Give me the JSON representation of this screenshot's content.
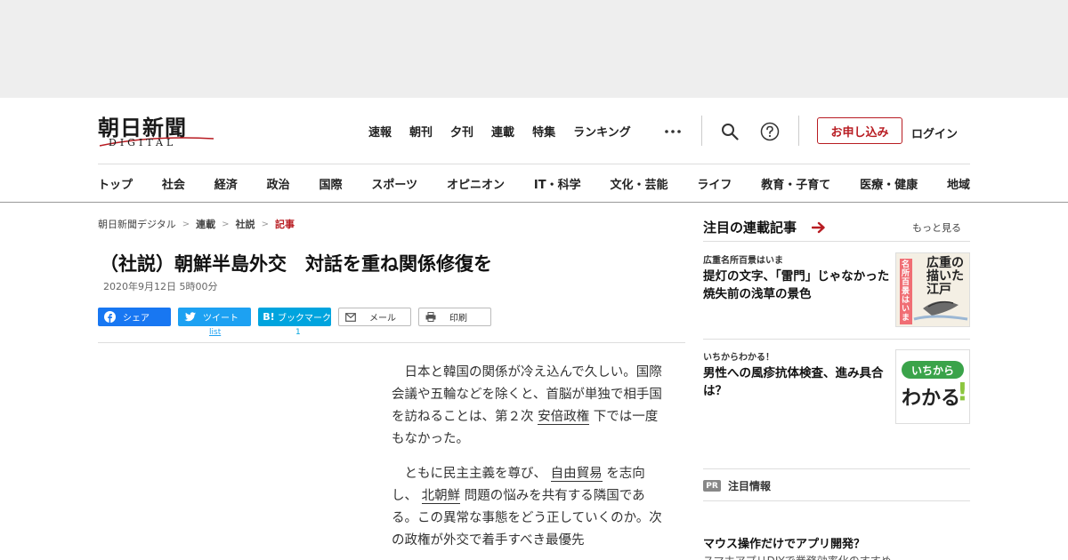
{
  "header": {
    "logo_main": "朝日新聞",
    "logo_sub": "DIGITAL",
    "top_nav": [
      "速報",
      "朝刊",
      "夕刊",
      "連載",
      "特集",
      "ランキング"
    ],
    "subscribe_label": "お申し込み",
    "login_label": "ログイン"
  },
  "categories": [
    "トップ",
    "社会",
    "経済",
    "政治",
    "国際",
    "スポーツ",
    "オピニオン",
    "IT・科学",
    "文化・芸能",
    "ライフ",
    "教育・子育て",
    "医療・健康",
    "地域"
  ],
  "breadcrumb": {
    "home": "朝日新聞デジタル",
    "level1": "連載",
    "level2": "社説",
    "current": "記事"
  },
  "article": {
    "title": "（社説）朝鮮半島外交　対話を重ね関係修復を",
    "date": "2020年9月12日 5時00分",
    "p1_a": "　日本と韓国の関係が冷え込んで久しい。国際会議や五輪などを除くと、首脳が単独で相手国を訪ねることは、第２次 ",
    "p1_link": "安倍政権",
    "p1_b": " 下では一度もなかった。",
    "p2_a": "　ともに民主主義を尊び、 ",
    "p2_link1": "自由貿易",
    "p2_b": " を志向し、 ",
    "p2_link2": "北朝鮮",
    "p2_c": " 問題の悩みを共有する隣国である。この異常な事態をどう正していくのか。次の政権が外交で着手すべき最優先"
  },
  "share": {
    "facebook": "シェア",
    "twitter": "ツイート",
    "hatena": "ブックマーク",
    "mail": "メール",
    "print": "印刷",
    "twitter_count": "list",
    "hatena_count": "1"
  },
  "sidebar": {
    "title": "注目の連載記事",
    "more": "もっと見る",
    "cards": [
      {
        "category": "広重名所百景はいま",
        "title": "提灯の文字、「雷門」じゃなかった　焼失前の浅草の景色"
      },
      {
        "category": "いちからわかる！",
        "title": "男性への風疹抗体検査、進み具合は？"
      }
    ],
    "thumb1_text": "広重の描いた江戸",
    "thumb1_side": "名所百景はいま",
    "thumb2_text_top": "いちから",
    "thumb2_text_bottom": "わかる",
    "thumb2_mark": "!",
    "pr_badge": "PR",
    "pr_label": "注目情報",
    "pr_title": "マウス操作だけでアプリ開発？",
    "pr_sub": "スマホアプリDIYで業務効率化のすすめ"
  },
  "colors": {
    "accent_red": "#b81c22",
    "facebook_blue": "#1877f2",
    "twitter_blue": "#1da1f2",
    "hatena_blue": "#00a4de"
  }
}
